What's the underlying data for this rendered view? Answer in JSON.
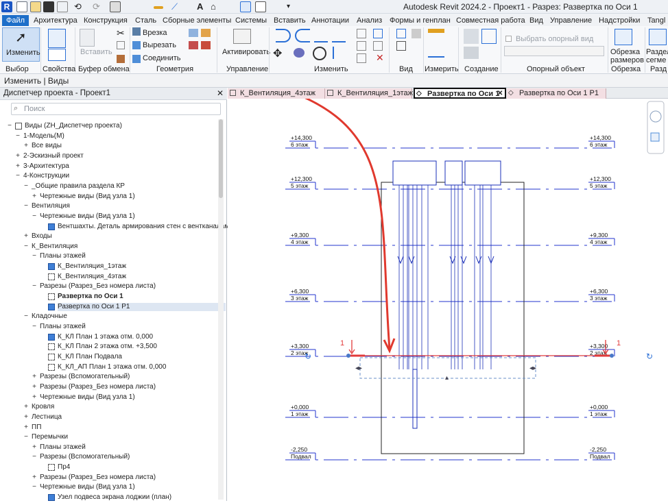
{
  "titlebar": {
    "logo": "R",
    "title": "Autodesk Revit 2024.2 - Проект1 - Разрез: Развертка по Оси 1"
  },
  "ribbon_tabs": [
    "Файл",
    "Архитектура",
    "Конструкция",
    "Сталь",
    "Сборные элементы",
    "Системы",
    "Вставить",
    "Аннотации",
    "Анализ",
    "Формы и генплан",
    "Совместная работа",
    "Вид",
    "Управление",
    "Надстройки",
    "Tangl"
  ],
  "ribbon": {
    "modify_label": "Изменить",
    "paste_label": "Вставить",
    "cut_label": "Врезка",
    "cutout_label": "Вырезать",
    "join_label": "Соединить",
    "activate_label": "Активировать",
    "workplane_placeholder": "Выбрать опорный вид",
    "crop_label": "Обрезка размеров",
    "split_label": "Раздел сегме",
    "groups": [
      "Выбор",
      "Свойства",
      "Буфер обмена",
      "Геометрия",
      "Управление",
      "Изменить",
      "Вид",
      "Измерить",
      "Создание",
      "Опорный объект",
      "Обрезка",
      "Разд"
    ]
  },
  "options_bar": "Изменить | Виды",
  "browser": {
    "header": "Диспетчер проекта - Проект1",
    "search_placeholder": "Поиск",
    "items": [
      {
        "exp": "−",
        "label": "Виды (ZH_Диспетчер проекта)",
        "icon": "views-icon"
      },
      {
        "exp": "−",
        "label": "1-Модель(М)"
      },
      {
        "exp": "+",
        "label": "Все виды"
      },
      {
        "exp": "+",
        "label": "2-Эскизный проект"
      },
      {
        "exp": "+",
        "label": "3-Архитектура"
      },
      {
        "exp": "−",
        "label": "4-Конструкции"
      },
      {
        "exp": "−",
        "label": "_Общие правила раздела КР"
      },
      {
        "exp": "+",
        "label": "Чертежные виды (Вид узла 1)"
      },
      {
        "exp": "−",
        "label": "Вентиляция"
      },
      {
        "exp": "−",
        "label": "Чертежные виды (Вид узла 1)"
      },
      {
        "exp": "",
        "label": "Вентшахты. Деталь армирования стен с вентканалами.",
        "icon": "b"
      },
      {
        "exp": "+",
        "label": "Входы"
      },
      {
        "exp": "−",
        "label": "К_Вентиляция"
      },
      {
        "exp": "−",
        "label": "Планы этажей"
      },
      {
        "exp": "",
        "label": "К_Вентиляция_1этаж",
        "icon": "b"
      },
      {
        "exp": "",
        "label": "К_Вентиляция_4этаж",
        "icon": "d"
      },
      {
        "exp": "−",
        "label": "Разрезы (Разрез_Без номера листа)"
      },
      {
        "exp": "",
        "label": "Развертка по Оси 1",
        "icon": "d",
        "bold": true
      },
      {
        "exp": "",
        "label": "Развертка по Оси 1 Р1",
        "icon": "b",
        "sel": true
      },
      {
        "exp": "−",
        "label": "Кладочные"
      },
      {
        "exp": "−",
        "label": "Планы этажей"
      },
      {
        "exp": "",
        "label": "К_КЛ План 1 этажа отм. 0,000",
        "icon": "b"
      },
      {
        "exp": "",
        "label": "К_КЛ План 2 этажа отм. +3,500",
        "icon": "d"
      },
      {
        "exp": "",
        "label": "К_КЛ План Подвала",
        "icon": "d"
      },
      {
        "exp": "",
        "label": "К_КЛ_АП План 1 этажа отм. 0,000",
        "icon": "d"
      },
      {
        "exp": "+",
        "label": "Разрезы (Вспомогательный)"
      },
      {
        "exp": "+",
        "label": "Разрезы (Разрез_Без номера листа)"
      },
      {
        "exp": "+",
        "label": "Чертежные виды (Вид узла 1)"
      },
      {
        "exp": "+",
        "label": "Кровля"
      },
      {
        "exp": "+",
        "label": "Лестница"
      },
      {
        "exp": "+",
        "label": "ПП"
      },
      {
        "exp": "−",
        "label": "Перемычки"
      },
      {
        "exp": "+",
        "label": "Планы этажей"
      },
      {
        "exp": "−",
        "label": "Разрезы (Вспомогательный)"
      },
      {
        "exp": "",
        "label": "Пр4",
        "icon": "d"
      },
      {
        "exp": "+",
        "label": "Разрезы (Разрез_Без номера листа)"
      },
      {
        "exp": "−",
        "label": "Чертежные виды (Вид узла 1)"
      },
      {
        "exp": "",
        "label": "Узел подвеса экрана лоджии (план)",
        "icon": "b"
      }
    ]
  },
  "doc_tabs": [
    "К_Вентиляция_4этаж",
    "К_Вентиляция_1этаж",
    "Развертка по Оси 1",
    "Развертка по Оси 1 Р1"
  ],
  "levels": [
    {
      "elev": "+14,300",
      "name": "6 этаж"
    },
    {
      "elev": "+12,300",
      "name": "5 этаж"
    },
    {
      "elev": "+9,300",
      "name": "4 этаж"
    },
    {
      "elev": "+6,300",
      "name": "3 этаж"
    },
    {
      "elev": "+3,300",
      "name": "2 этаж"
    },
    {
      "elev": "+0,000",
      "name": "1 этаж"
    },
    {
      "elev": "-2,250",
      "name": "Подвал"
    }
  ],
  "section_marker": "1"
}
